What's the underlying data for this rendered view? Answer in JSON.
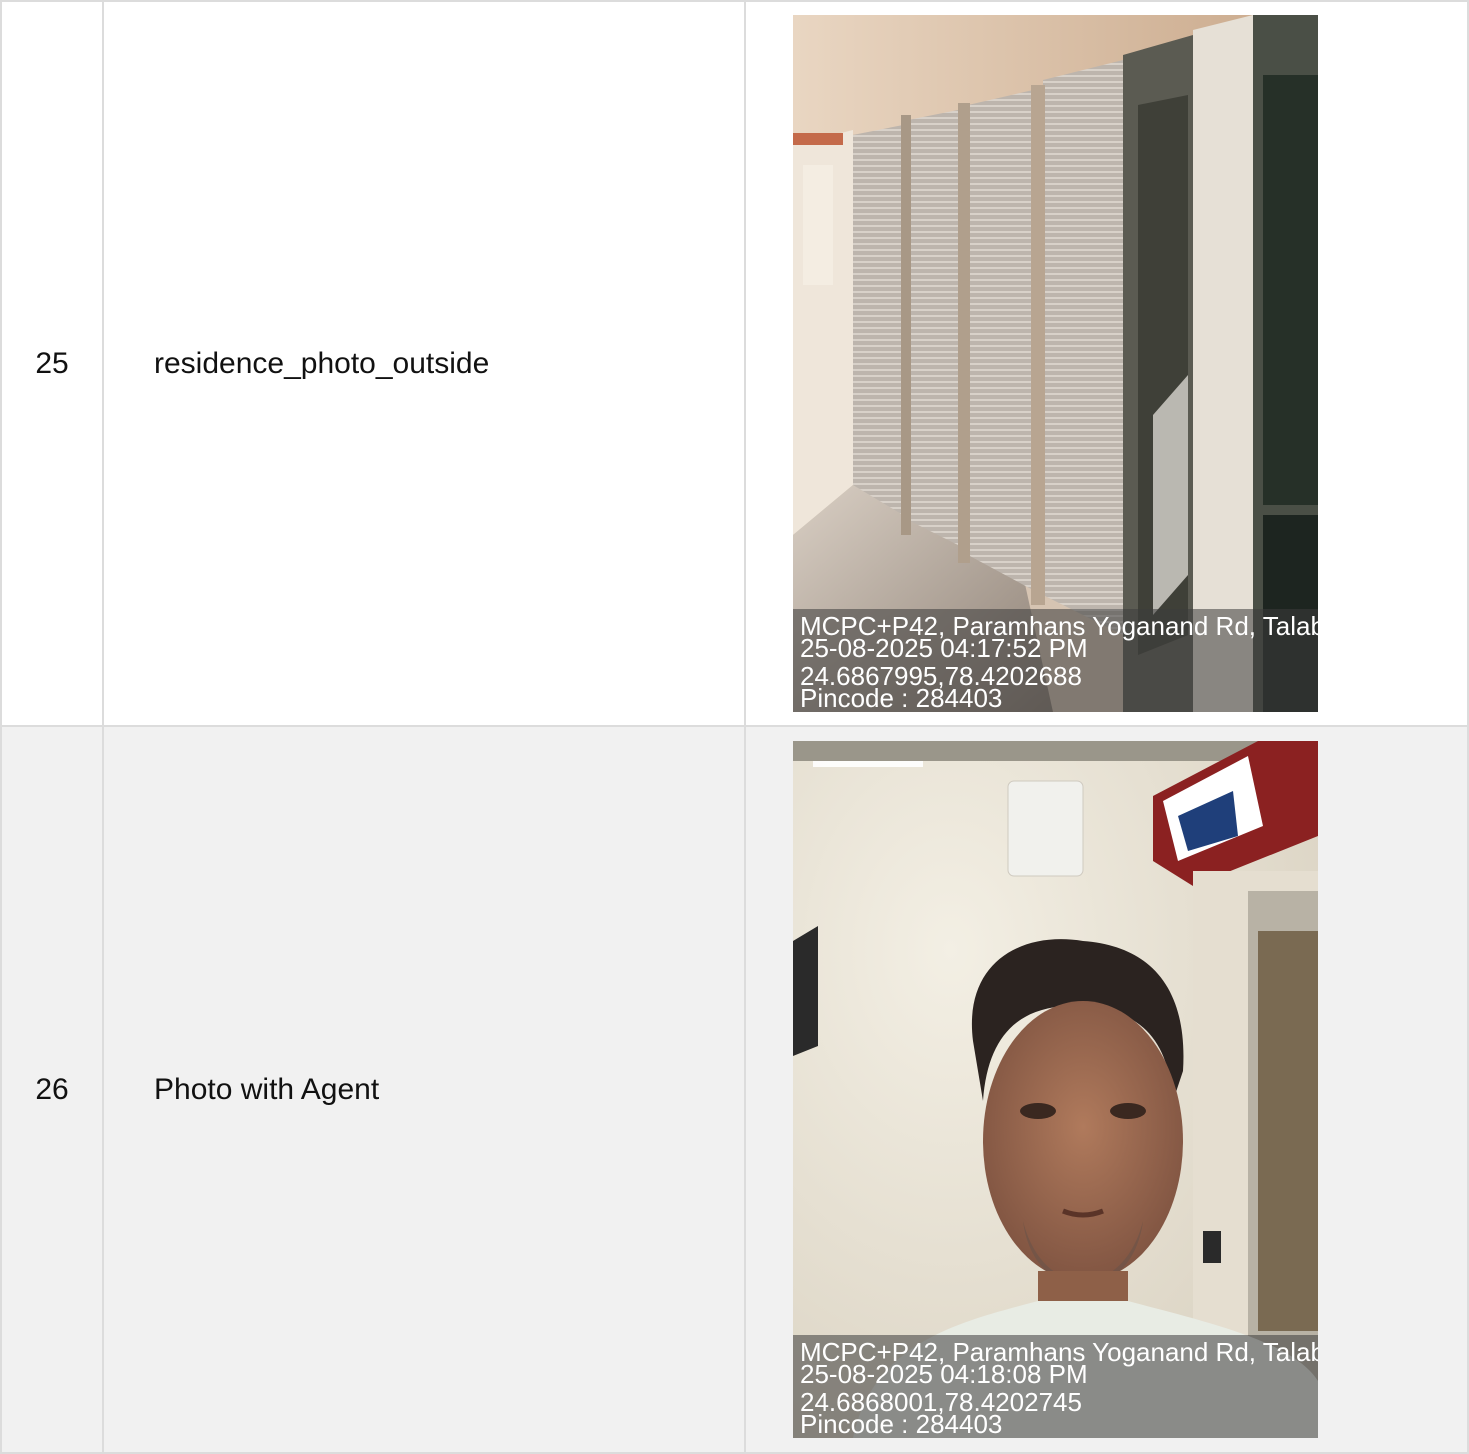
{
  "rows": [
    {
      "number": "25",
      "label": "residence_photo_outside",
      "photo": {
        "subject": "shop-shutters-corridor",
        "stamp": {
          "address": "MCPC+P42, Paramhans Yoganand Rd, Talab",
          "datetime": "25-08-2025 04:17:52 PM",
          "coords": "24.6867995,78.4202688",
          "pincode": "Pincode : 284403"
        }
      }
    },
    {
      "number": "26",
      "label": "Photo with Agent",
      "photo": {
        "subject": "man-selfie-in-shop",
        "stamp": {
          "address": "MCPC+P42, Paramhans Yoganand Rd, Talab",
          "datetime": "25-08-2025 04:18:08 PM",
          "coords": "24.6868001,78.4202745",
          "pincode": "Pincode : 284403"
        }
      }
    }
  ],
  "colors": {
    "border": "#dcdcdc",
    "row_alt_bg": "#f1f1f1",
    "stamp_text": "#ffffff"
  }
}
